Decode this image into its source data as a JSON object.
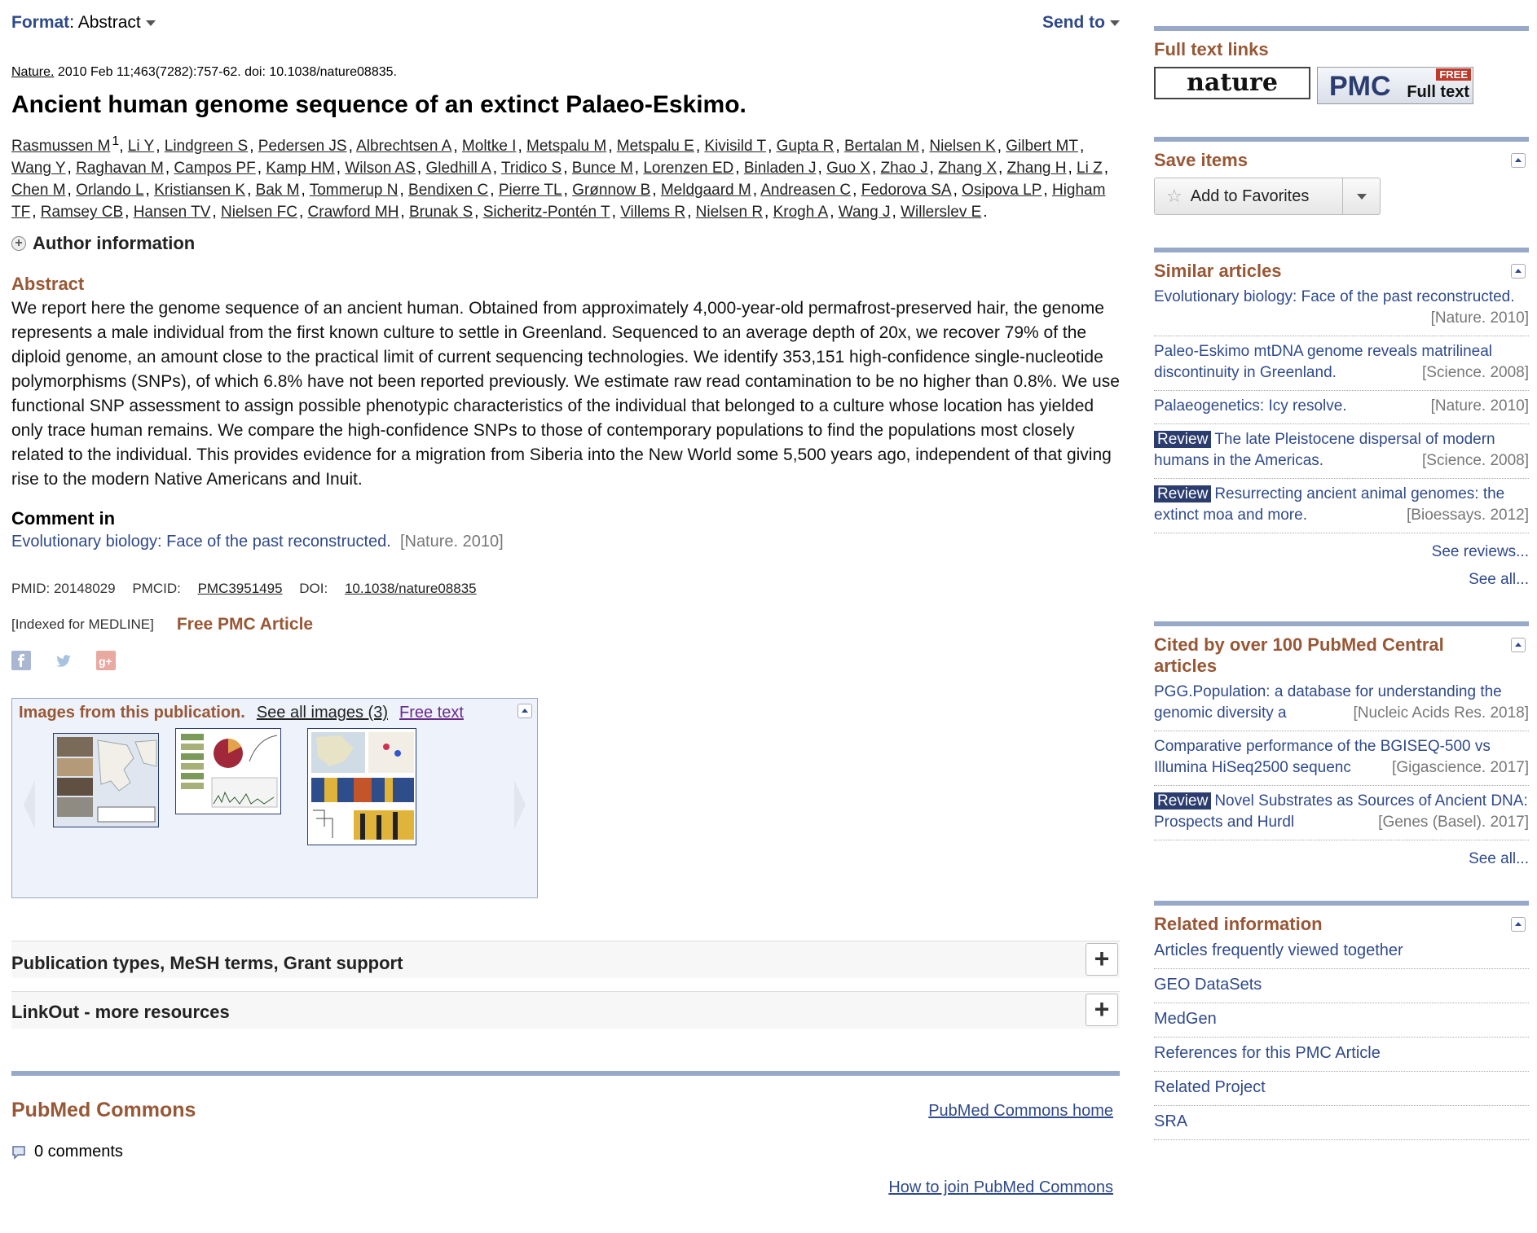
{
  "topbar": {
    "format_label": "Format",
    "format_value": "Abstract",
    "send_to": "Send to"
  },
  "citation": {
    "journal": "Nature.",
    "details": "2010 Feb 11;463(7282):757-62. doi: 10.1038/nature08835."
  },
  "title": "Ancient human genome sequence of an extinct Palaeo-Eskimo.",
  "authors": [
    "Rasmussen M",
    "Li Y",
    "Lindgreen S",
    "Pedersen JS",
    "Albrechtsen A",
    "Moltke I",
    "Metspalu M",
    "Metspalu E",
    "Kivisild T",
    "Gupta R",
    "Bertalan M",
    "Nielsen K",
    "Gilbert MT",
    "Wang Y",
    "Raghavan M",
    "Campos PF",
    "Kamp HM",
    "Wilson AS",
    "Gledhill A",
    "Tridico S",
    "Bunce M",
    "Lorenzen ED",
    "Binladen J",
    "Guo X",
    "Zhao J",
    "Zhang X",
    "Zhang H",
    "Li Z",
    "Chen M",
    "Orlando L",
    "Kristiansen K",
    "Bak M",
    "Tommerup N",
    "Bendixen C",
    "Pierre TL",
    "Grønnow B",
    "Meldgaard M",
    "Andreasen C",
    "Fedorova SA",
    "Osipova LP",
    "Higham TF",
    "Ramsey CB",
    "Hansen TV",
    "Nielsen FC",
    "Crawford MH",
    "Brunak S",
    "Sicheritz-Pontén T",
    "Villems R",
    "Nielsen R",
    "Krogh A",
    "Wang J",
    "Willerslev E"
  ],
  "first_author_sup": "1",
  "author_info": "Author information",
  "abstract": {
    "heading": "Abstract",
    "text": "We report here the genome sequence of an ancient human. Obtained from approximately 4,000-year-old permafrost-preserved hair, the genome represents a male individual from the first known culture to settle in Greenland. Sequenced to an average depth of 20x, we recover 79% of the diploid genome, an amount close to the practical limit of current sequencing technologies. We identify 353,151 high-confidence single-nucleotide polymorphisms (SNPs), of which 6.8% have not been reported previously. We estimate raw read contamination to be no higher than 0.8%. We use functional SNP assessment to assign possible phenotypic characteristics of the individual that belonged to a culture whose location has yielded only trace human remains. We compare the high-confidence SNPs to those of contemporary populations to find the populations most closely related to the individual. This provides evidence for a migration from Siberia into the New World some 5,500 years ago, independent of that giving rise to the modern Native Americans and Inuit."
  },
  "comment": {
    "heading": "Comment in",
    "link": "Evolutionary biology: Face of the past reconstructed.",
    "source": "[Nature. 2010]"
  },
  "ids": {
    "pmid": "PMID: 20148029",
    "pmcid_label": "PMCID:",
    "pmcid": "PMC3951495",
    "doi_label": "DOI:",
    "doi": "10.1038/nature08835"
  },
  "indexed": "[Indexed for MEDLINE]",
  "free_pmc": "Free PMC Article",
  "images": {
    "title": "Images from this publication.",
    "see_all": "See all images (3)",
    "free_text": "Free text"
  },
  "sections": {
    "pub_types": "Publication types, MeSH terms, Grant support",
    "linkout": "LinkOut - more resources"
  },
  "commons": {
    "heading": "PubMed Commons",
    "home": "PubMed Commons home",
    "comments": "0 comments",
    "join": "How to join PubMed Commons"
  },
  "sidebar": {
    "fulltext_heading": "Full text links",
    "nature_logo": "nature",
    "pmc_logo": "PMC",
    "pmc_free": "FREE",
    "pmc_full": "Full text",
    "save_heading": "Save items",
    "add_fav": "Add to Favorites",
    "similar_heading": "Similar articles",
    "similar": [
      {
        "review": false,
        "title": "Evolutionary biology: Face of the past reconstructed.",
        "src": "[Nature. 2010]"
      },
      {
        "review": false,
        "title": "Paleo-Eskimo mtDNA genome reveals matrilineal discontinuity in Greenland.",
        "src": "[Science. 2008]"
      },
      {
        "review": false,
        "title": "Palaeogenetics: Icy resolve.",
        "src": "[Nature. 2010]"
      },
      {
        "review": true,
        "title": "The late Pleistocene dispersal of modern humans in the Americas.",
        "src": "[Science. 2008]"
      },
      {
        "review": true,
        "title": "Resurrecting ancient animal genomes: the extinct moa and more.",
        "src": "[Bioessays. 2012]"
      }
    ],
    "review_badge": "Review",
    "see_reviews": "See reviews...",
    "see_all": "See all...",
    "cited_heading": "Cited by over 100 PubMed Central articles",
    "cited": [
      {
        "review": false,
        "title": "PGG.Population: a database for understanding the genomic diversity a",
        "src": "[Nucleic Acids Res. 2018]"
      },
      {
        "review": false,
        "title": "Comparative performance of the BGISEQ-500 vs Illumina HiSeq2500 sequenc",
        "src": "[Gigascience. 2017]"
      },
      {
        "review": true,
        "title": "Novel Substrates as Sources of Ancient DNA: Prospects and Hurdl",
        "src": "[Genes (Basel). 2017]"
      }
    ],
    "related_heading": "Related information",
    "related": [
      "Articles frequently viewed together",
      "GEO DataSets",
      "MedGen",
      "References for this PMC Article",
      "Related Project",
      "SRA"
    ]
  }
}
